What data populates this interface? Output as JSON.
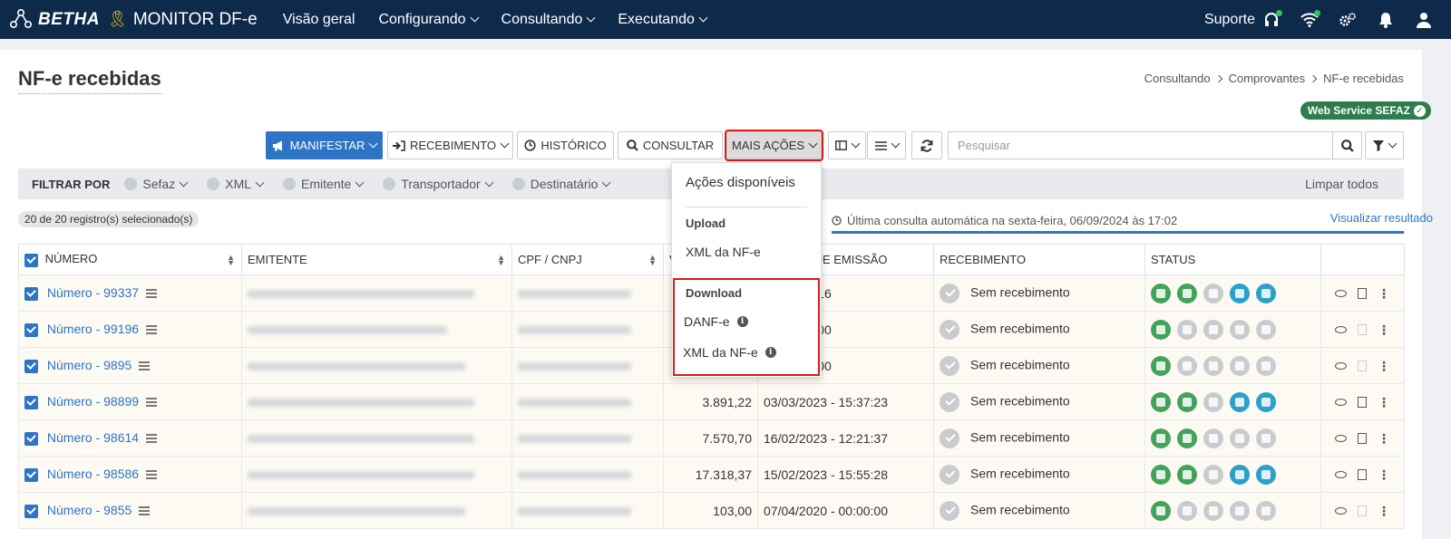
{
  "topbar": {
    "brand": "BETHA",
    "product": "MONITOR DF-e",
    "nav": [
      {
        "label": "Visão geral",
        "has_menu": false
      },
      {
        "label": "Configurando",
        "has_menu": true
      },
      {
        "label": "Consultando",
        "has_menu": true
      },
      {
        "label": "Executando",
        "has_menu": true
      }
    ],
    "support_label": "Suporte"
  },
  "page": {
    "title": "NF-e recebidas",
    "breadcrumb": [
      "Consultando",
      "Comprovantes",
      "NF-e recebidas"
    ],
    "ws_badge": "Web Service SEFAZ"
  },
  "toolbar": {
    "manifestar": "MANIFESTAR",
    "recebimento": "RECEBIMENTO",
    "historico": "HISTÓRICO",
    "consultar": "CONSULTAR",
    "mais_acoes": "MAIS AÇÕES",
    "search_placeholder": "Pesquisar"
  },
  "filters": {
    "label": "FILTRAR POR",
    "items": [
      "Sefaz",
      "XML",
      "Emitente",
      "Transportador",
      "Destinatário"
    ],
    "clear": "Limpar todos"
  },
  "selection": "20 de 20 registro(s) selecionado(s)",
  "last_query": "Última consulta automática na sexta-feira, 06/09/2024 às 17:02",
  "view_result": "Visualizar resultado",
  "table": {
    "headers": [
      "NÚMERO",
      "EMITENTE",
      "CPF / CNPJ",
      "V",
      "A DE EMISSÃO",
      "RECEBIMENTO",
      "STATUS"
    ],
    "rows": [
      {
        "numero": "Número - 99337",
        "valor": "",
        "emissao": "3 - 14:35:16",
        "recebimento": "Sem recebimento",
        "status": [
          "green",
          "green",
          "gray",
          "teal",
          "teal"
        ],
        "pdf": true
      },
      {
        "numero": "Número - 99196",
        "valor": "",
        "emissao": "4 - 00:00:00",
        "recebimento": "Sem recebimento",
        "status": [
          "green",
          "gray",
          "gray",
          "gray",
          "gray"
        ],
        "pdf": false
      },
      {
        "numero": "Número - 9895",
        "valor": "",
        "emissao": "0 - 00:00:00",
        "recebimento": "Sem recebimento",
        "status": [
          "green",
          "gray",
          "gray",
          "gray",
          "gray"
        ],
        "pdf": false
      },
      {
        "numero": "Número - 98899",
        "valor": "3.891,22",
        "emissao": "03/03/2023 - 15:37:23",
        "recebimento": "Sem recebimento",
        "status": [
          "green",
          "green",
          "gray",
          "teal",
          "teal"
        ],
        "pdf": true
      },
      {
        "numero": "Número - 98614",
        "valor": "7.570,70",
        "emissao": "16/02/2023 - 12:21:37",
        "recebimento": "Sem recebimento",
        "status": [
          "green",
          "green",
          "gray",
          "gray",
          "gray"
        ],
        "pdf": true
      },
      {
        "numero": "Número - 98586",
        "valor": "17.318,37",
        "emissao": "15/02/2023 - 15:55:28",
        "recebimento": "Sem recebimento",
        "status": [
          "green",
          "green",
          "gray",
          "teal",
          "teal"
        ],
        "pdf": true
      },
      {
        "numero": "Número - 9855",
        "valor": "103,00",
        "emissao": "07/04/2020 - 00:00:00",
        "recebimento": "Sem recebimento",
        "status": [
          "green",
          "gray",
          "gray",
          "gray",
          "gray"
        ],
        "pdf": false
      }
    ]
  },
  "dropdown": {
    "header": "Ações disponíveis",
    "upload_section": "Upload",
    "upload_items": [
      "XML da NF-e"
    ],
    "download_section": "Download",
    "download_items": [
      "DANF-e",
      "XML da NF-e"
    ]
  },
  "colors": {
    "topbar": "#0e2a4b",
    "primary": "#2e74c4",
    "highlight": "#e01818",
    "status_green": "#43a35a",
    "status_teal": "#2ba0c8",
    "badge_green": "#2e7d4f"
  }
}
